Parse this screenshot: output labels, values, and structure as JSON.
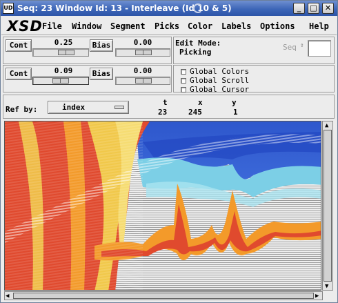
{
  "window": {
    "title": "Seq: 23 Window Id: 13 - Interleave (Id 10 & 5)",
    "app_icon_text": "UD",
    "minimize": "_",
    "maximize": "□",
    "close": "✕"
  },
  "menubar": {
    "logo": "XSD",
    "items": [
      "File",
      "Window",
      "Segment",
      "Picks",
      "Color",
      "Labels",
      "Options",
      "Help"
    ]
  },
  "controls": {
    "row1": {
      "cont_label": "Cont",
      "cont_value": "0.25",
      "bias_label": "Bias",
      "bias_value": "0.00"
    },
    "row2": {
      "cont_label": "Cont",
      "cont_value": "0.09",
      "bias_label": "Bias",
      "bias_value": "0.00"
    },
    "edit_mode_label": "Edit Mode:",
    "edit_mode_value": "Picking",
    "seq_label": "Seq",
    "seq_value": "",
    "global_colors": "Global Colors",
    "global_scroll": "Global Scroll",
    "global_cursor": "Global Cursor",
    "ref_by_label": "Ref by:",
    "ref_by_value": "index",
    "coords": {
      "t_label": "t",
      "x_label": "x",
      "y_label": "y",
      "t": "23",
      "x": "245",
      "y": "1"
    }
  },
  "colors": {
    "titlebar": "#3d66b8",
    "red": "#e04a2e",
    "orange": "#f39a2a",
    "yellow": "#f1c84a",
    "blue": "#2f57cc",
    "cyan": "#7fd0e8"
  }
}
